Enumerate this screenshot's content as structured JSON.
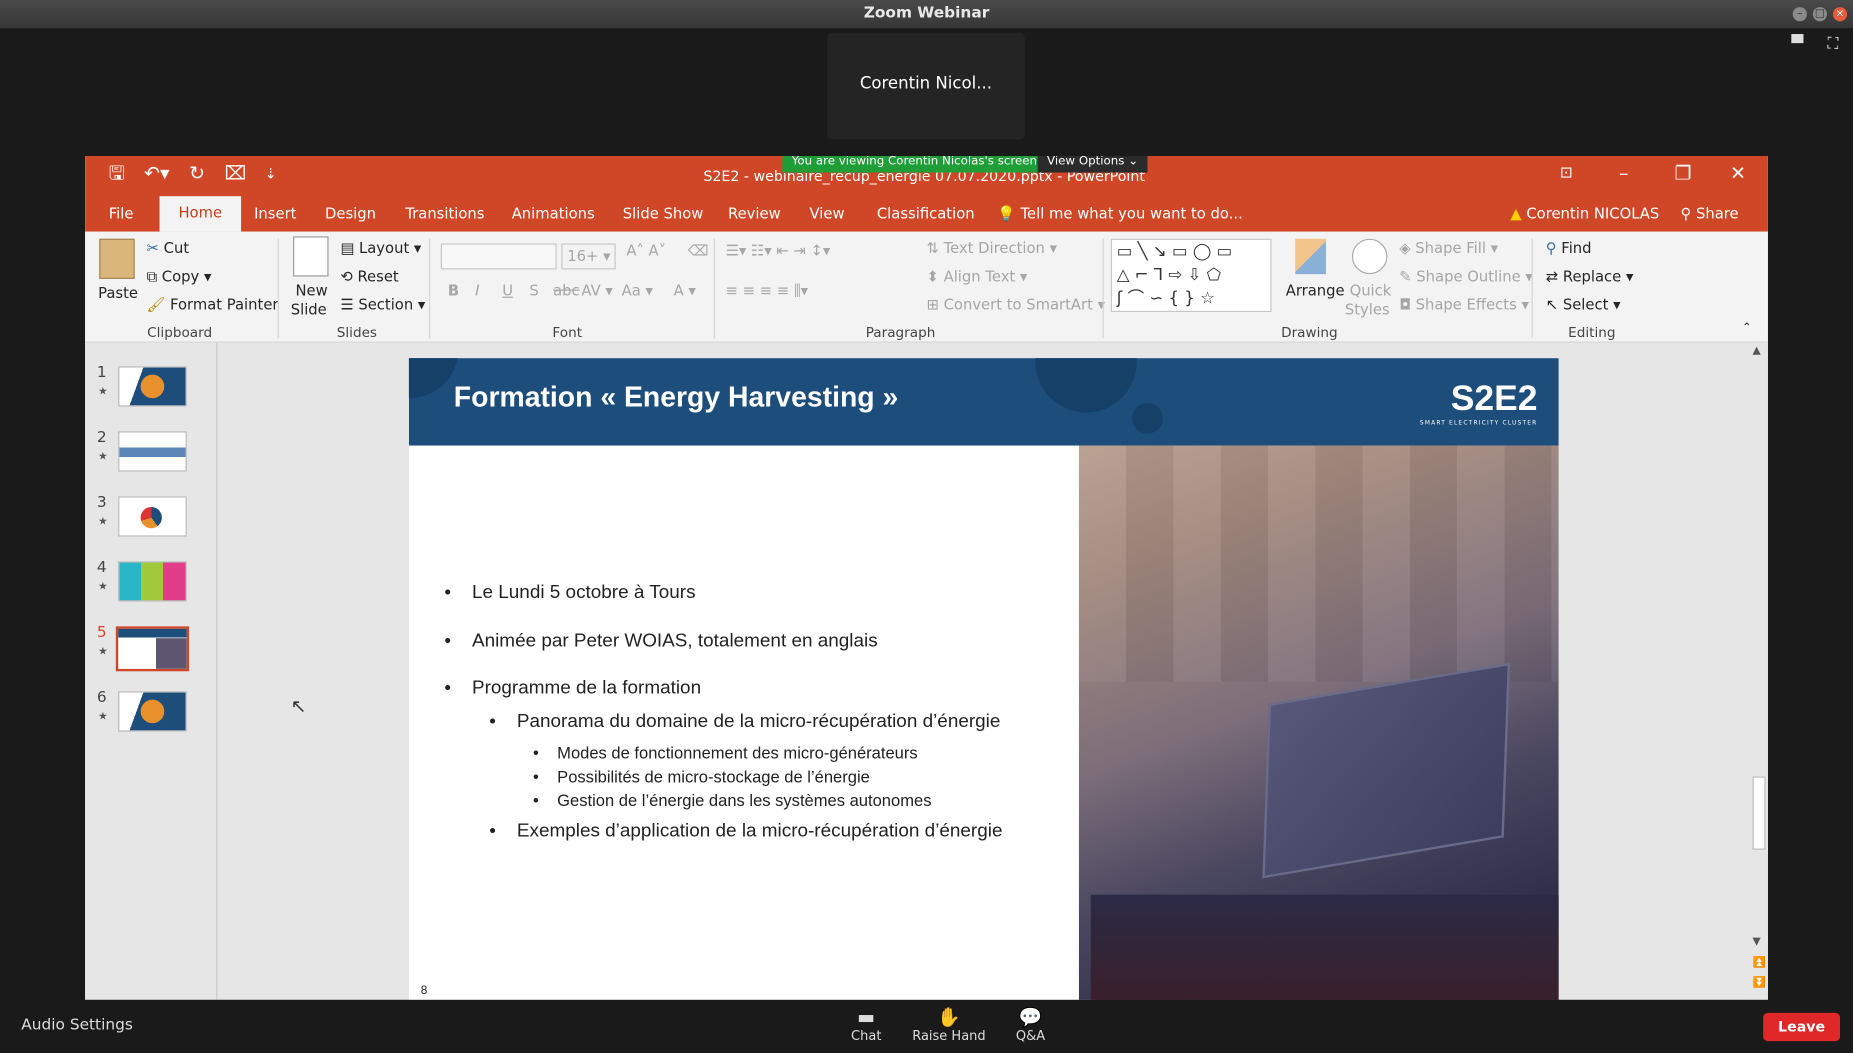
{
  "zoom": {
    "window_title": "Zoom Webinar",
    "participant_name": "Corentin Nicol...",
    "share_banner": "You are viewing Corentin Nicolas's screen",
    "view_options": "View Options",
    "audio_settings": "Audio Settings",
    "chat_label": "Chat",
    "raise_hand_label": "Raise Hand",
    "qa_label": "Q&A",
    "leave_label": "Leave"
  },
  "ppt": {
    "doc_title": "S2E2 - webinaire_recup_energie 07.07.2020.pptx - PowerPoint",
    "tabs": [
      "File",
      "Home",
      "Insert",
      "Design",
      "Transitions",
      "Animations",
      "Slide Show",
      "Review",
      "View",
      "Classification"
    ],
    "tell_me": "Tell me what you want to do...",
    "user": "Corentin NICOLAS",
    "share": "Share",
    "ribbon": {
      "paste": "Paste",
      "cut": "Cut",
      "copy": "Copy",
      "format_painter": "Format Painter",
      "clipboard": "Clipboard",
      "new_slide_1": "New",
      "new_slide_2": "Slide",
      "layout": "Layout",
      "reset": "Reset",
      "section": "Section",
      "slides": "Slides",
      "font_size": "16+",
      "font": "Font",
      "paragraph": "Paragraph",
      "text_direction": "Text Direction",
      "align_text": "Align Text",
      "convert_smartart": "Convert to SmartArt",
      "arrange": "Arrange",
      "quick_styles_1": "Quick",
      "quick_styles_2": "Styles",
      "shape_fill": "Shape Fill",
      "shape_outline": "Shape Outline",
      "shape_effects": "Shape Effects",
      "drawing": "Drawing",
      "find": "Find",
      "replace": "Replace",
      "select": "Select",
      "editing": "Editing"
    },
    "thumbnails": [
      "1",
      "2",
      "3",
      "4",
      "5",
      "6"
    ],
    "selected_slide": 5
  },
  "slide": {
    "title": "Formation « Energy Harvesting »",
    "logo": "S2E2",
    "logo_sub": "SMART ELECTRICITY CLUSTER",
    "page_number": "8",
    "bullets": {
      "b1": "Le Lundi 5 octobre à Tours",
      "b2": "Animée par Peter WOIAS, totalement en anglais",
      "b3": "Programme de la formation",
      "b3a": "Panorama du domaine de la micro-récupération d’énergie",
      "b3a1": "Modes de fonctionnement des micro-générateurs",
      "b3a2": "Possibilités de micro-stockage de l’énergie",
      "b3a3": "Gestion de l’énergie dans les systèmes autonomes",
      "b3b": "Exemples d’application de la micro-récupération d’énergie"
    }
  },
  "colors": {
    "ppt_accent": "#d04727",
    "slide_header": "#1d4d7b",
    "zoom_leave": "#e02828",
    "share_banner": "#1f9e38"
  }
}
